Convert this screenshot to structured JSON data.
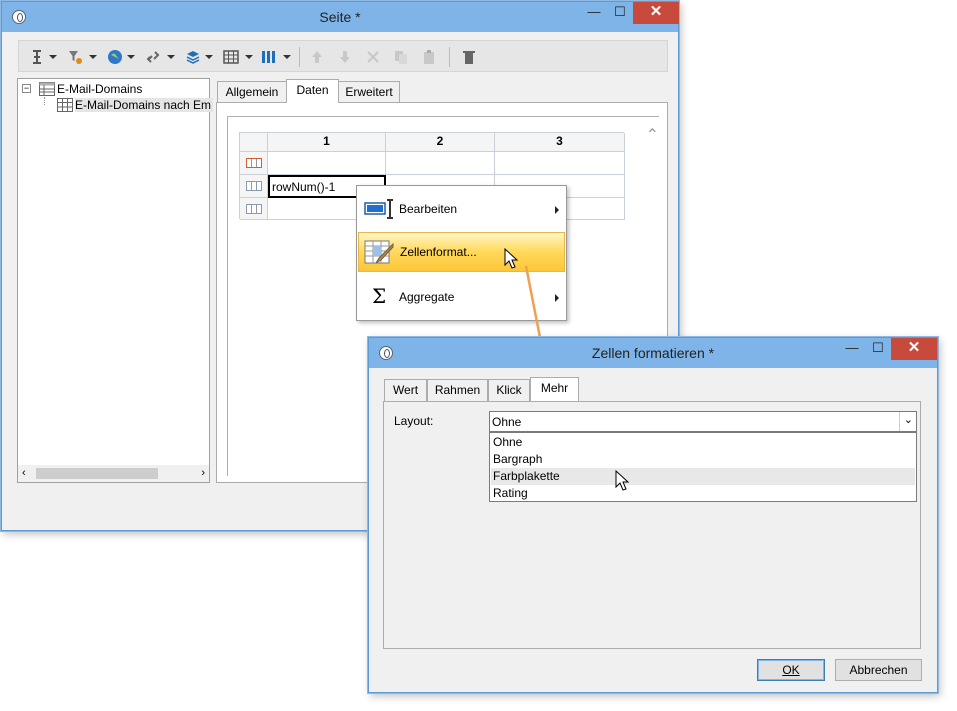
{
  "main_window": {
    "title": "Seite *",
    "controls": {
      "minimize": "—",
      "maximize": "☐",
      "close": "✕"
    },
    "tree": {
      "root": "E-Mail-Domains",
      "child": "E-Mail-Domains nach Em"
    },
    "tabs": [
      "Allgemein",
      "Daten",
      "Erweitert"
    ],
    "active_tab": "Daten",
    "grid": {
      "columns": [
        "1",
        "2",
        "3"
      ],
      "cell_value": "rowNum()-1"
    }
  },
  "context_menu": {
    "items": [
      {
        "label": "Bearbeiten",
        "icon": "edit-icon",
        "submenu": true
      },
      {
        "label": "Zellenformat...",
        "icon": "cell-format-icon",
        "submenu": false
      },
      {
        "label": "Aggregate",
        "icon": "sigma-icon",
        "submenu": true
      }
    ]
  },
  "dialog": {
    "title": "Zellen formatieren *",
    "controls": {
      "minimize": "—",
      "maximize": "☐",
      "close": "✕"
    },
    "tabs": [
      "Wert",
      "Rahmen",
      "Klick",
      "Mehr"
    ],
    "active_tab": "Mehr",
    "layout_label": "Layout:",
    "layout_value": "Ohne",
    "layout_options": [
      "Ohne",
      "Bargraph",
      "Farbplakette",
      "Rating"
    ],
    "hovered_option": "Farbplakette",
    "ok_label": "OK",
    "cancel_label": "Abbrechen"
  },
  "colors": {
    "titlebar": "#7fb4e8",
    "close_button": "#c74a3c",
    "menu_highlight": "#ffd95a",
    "arrow": "#f0a050"
  }
}
